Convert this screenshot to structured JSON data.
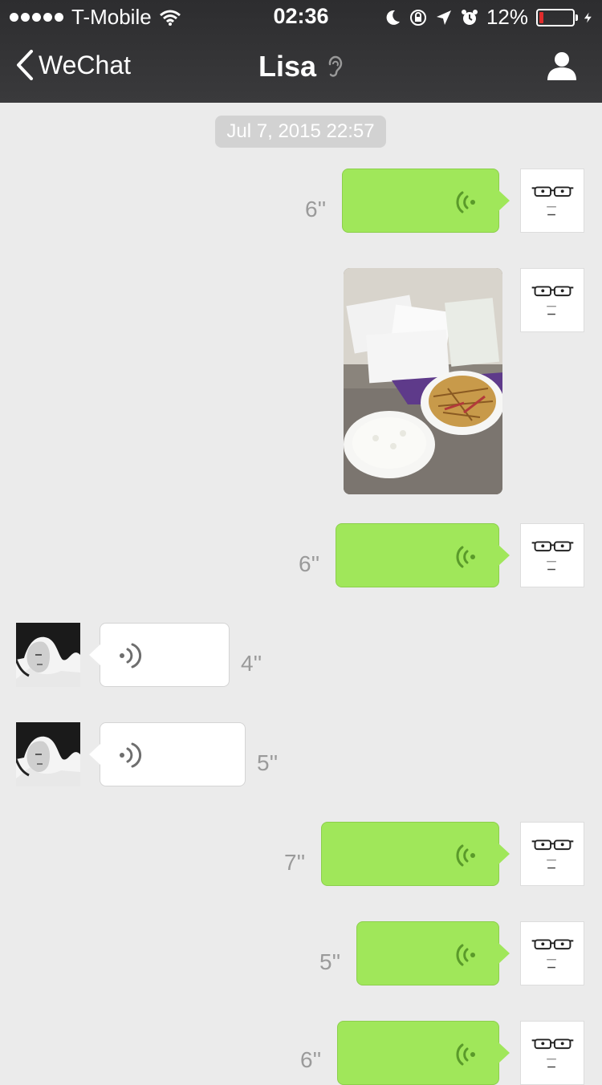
{
  "status_bar": {
    "carrier": "T-Mobile",
    "time": "02:36",
    "battery_percent": "12%",
    "battery_level": 0.12,
    "icons": [
      "signal-dots-icon",
      "wifi-icon",
      "moon-icon",
      "rotation-lock-icon",
      "location-arrow-icon",
      "alarm-icon",
      "battery-icon",
      "charging-bolt-icon"
    ]
  },
  "nav": {
    "back_label": "WeChat",
    "title": "Lisa",
    "icons": [
      "back-chevron-icon",
      "earpiece-mode-icon",
      "contact-profile-icon"
    ]
  },
  "chat": {
    "timestamp": "Jul 7, 2015 22:57",
    "messages": [
      {
        "from": "me",
        "type": "voice",
        "duration": "6''"
      },
      {
        "from": "me",
        "type": "image",
        "description": "photo"
      },
      {
        "from": "me",
        "type": "voice",
        "duration": "6''"
      },
      {
        "from": "lisa",
        "type": "voice",
        "duration": "4''"
      },
      {
        "from": "lisa",
        "type": "voice",
        "duration": "5''"
      },
      {
        "from": "me",
        "type": "voice",
        "duration": "7''"
      },
      {
        "from": "me",
        "type": "voice",
        "duration": "5''"
      },
      {
        "from": "me",
        "type": "voice",
        "duration": "6''"
      }
    ]
  },
  "colors": {
    "header_bg": "#333335",
    "chat_bg": "#ebebeb",
    "my_bubble": "#a0e75a",
    "their_bubble": "#ffffff",
    "battery_low": "#e02c2c"
  }
}
